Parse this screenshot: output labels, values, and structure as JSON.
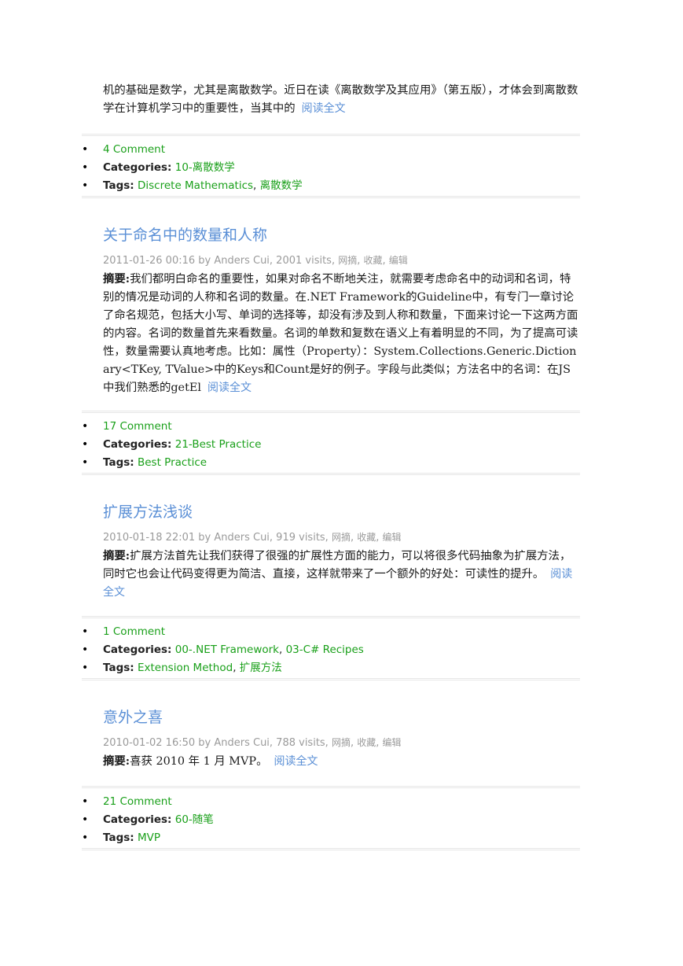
{
  "posts": [
    {
      "summary_text": "机的基础是数学，尤其是离散数学。近日在读《离散数学及其应用》（第五版），才体会到离散数学在计算机学习中的重要性，当其中的",
      "read_more": "阅读全文",
      "comments": "4 Comment",
      "categories_label": "Categories:",
      "categories": [
        "10-离散数学"
      ],
      "tags_label": "Tags:",
      "tags": [
        "Discrete Mathematics",
        "离散数学"
      ]
    },
    {
      "title": "关于命名中的数量和人称",
      "meta_prefix": "2011-01-26 00:16 by Anders Cui, 2001 visits,",
      "actions": [
        "网摘",
        "收藏",
        "编辑"
      ],
      "summary_label": "摘要:",
      "summary_text": "我们都明白命名的重要性，如果对命名不断地关注，就需要考虑命名中的动词和名词，特别的情况是动词的人称和名词的数量。在.NET Framework的Guideline中，有专门一章讨论了命名规范，包括大小写、单词的选择等，却没有涉及到人称和数量，下面来讨论一下这两方面的内容。名词的数量首先来看数量。名词的单数和复数在语义上有着明显的不同，为了提高可读性，数量需要认真地考虑。比如：属性（Property）：System.Collections.Generic.Dictionary<TKey, TValue>中的Keys和Count是好的例子。字段与此类似；方法名中的名词：在JS中我们熟悉的getEl",
      "read_more": "阅读全文",
      "comments": "17 Comment",
      "categories_label": "Categories:",
      "categories": [
        "21-Best Practice"
      ],
      "tags_label": "Tags:",
      "tags": [
        "Best Practice"
      ]
    },
    {
      "title": "扩展方法浅谈",
      "meta_prefix": "2010-01-18 22:01 by Anders Cui, 919 visits,",
      "actions": [
        "网摘",
        "收藏",
        "编辑"
      ],
      "summary_label": "摘要:",
      "summary_text": "扩展方法首先让我们获得了很强的扩展性方面的能力，可以将很多代码抽象为扩展方法，同时它也会让代码变得更为简洁、直接，这样就带来了一个额外的好处：可读性的提升。",
      "read_more": "阅读全文",
      "comments": "1 Comment",
      "categories_label": "Categories:",
      "categories": [
        "00-.NET Framework",
        "03-C# Recipes"
      ],
      "tags_label": "Tags:",
      "tags": [
        "Extension Method",
        "扩展方法"
      ]
    },
    {
      "title": "意外之喜",
      "meta_prefix": "2010-01-02 16:50 by Anders Cui, 788 visits,",
      "actions": [
        "网摘",
        "收藏",
        "编辑"
      ],
      "summary_label": "摘要:",
      "summary_text": "喜获 2010 年 1 月 MVP。",
      "read_more": "阅读全文",
      "comments": "21 Comment",
      "categories_label": "Categories:",
      "categories": [
        "60-随笔"
      ],
      "tags_label": "Tags:",
      "tags": [
        "MVP"
      ]
    }
  ],
  "colors": {
    "title_link": "#5a8fd6",
    "meta_link": "#1aa01a",
    "meta_text": "#9a9a9a"
  }
}
